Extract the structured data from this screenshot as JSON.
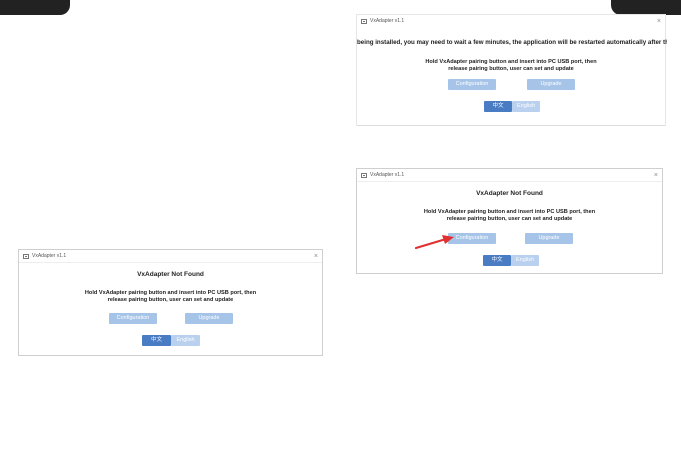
{
  "colors": {
    "accent_dark": "#4a7cc4",
    "accent_light": "#a6c4e8",
    "arrow": "#e03030",
    "corner": "#222222"
  },
  "icons": {
    "app": "app-icon",
    "close": "close-icon",
    "pointer": "red-arrow-icon"
  },
  "top_right_window": {
    "title": "VxAdapter v1.1",
    "close": "×",
    "message": "being installed, you may need to wait a few minutes, the application will be restarted automatically after the driver",
    "instruction_line1": "Hold VxAdapter pairing button and insert into PC USB port, then",
    "instruction_line2": "release pairing button, user can set and update",
    "configuration_label": "Configuration",
    "upgrade_label": "Upgrade",
    "zh_label": "中文",
    "en_label": "English"
  },
  "middle_right_window": {
    "title": "VxAdapter v1.1",
    "close": "×",
    "heading": "VxAdapter Not Found",
    "instruction_line1": "Hold VxAdapter pairing button and insert into PC USB port, then",
    "instruction_line2": "release pairing button, user can set and update",
    "configuration_label": "Configuration",
    "upgrade_label": "Upgrade",
    "zh_label": "中文",
    "en_label": "English"
  },
  "left_window": {
    "title": "VxAdapter v1.1",
    "close": "×",
    "heading": "VxAdapter Not Found",
    "instruction_line1": "Hold VxAdapter pairing button and insert into PC USB port, then",
    "instruction_line2": "release pairing button, user can set and update",
    "configuration_label": "Configuration",
    "upgrade_label": "Upgrade",
    "zh_label": "中文",
    "en_label": "English"
  }
}
